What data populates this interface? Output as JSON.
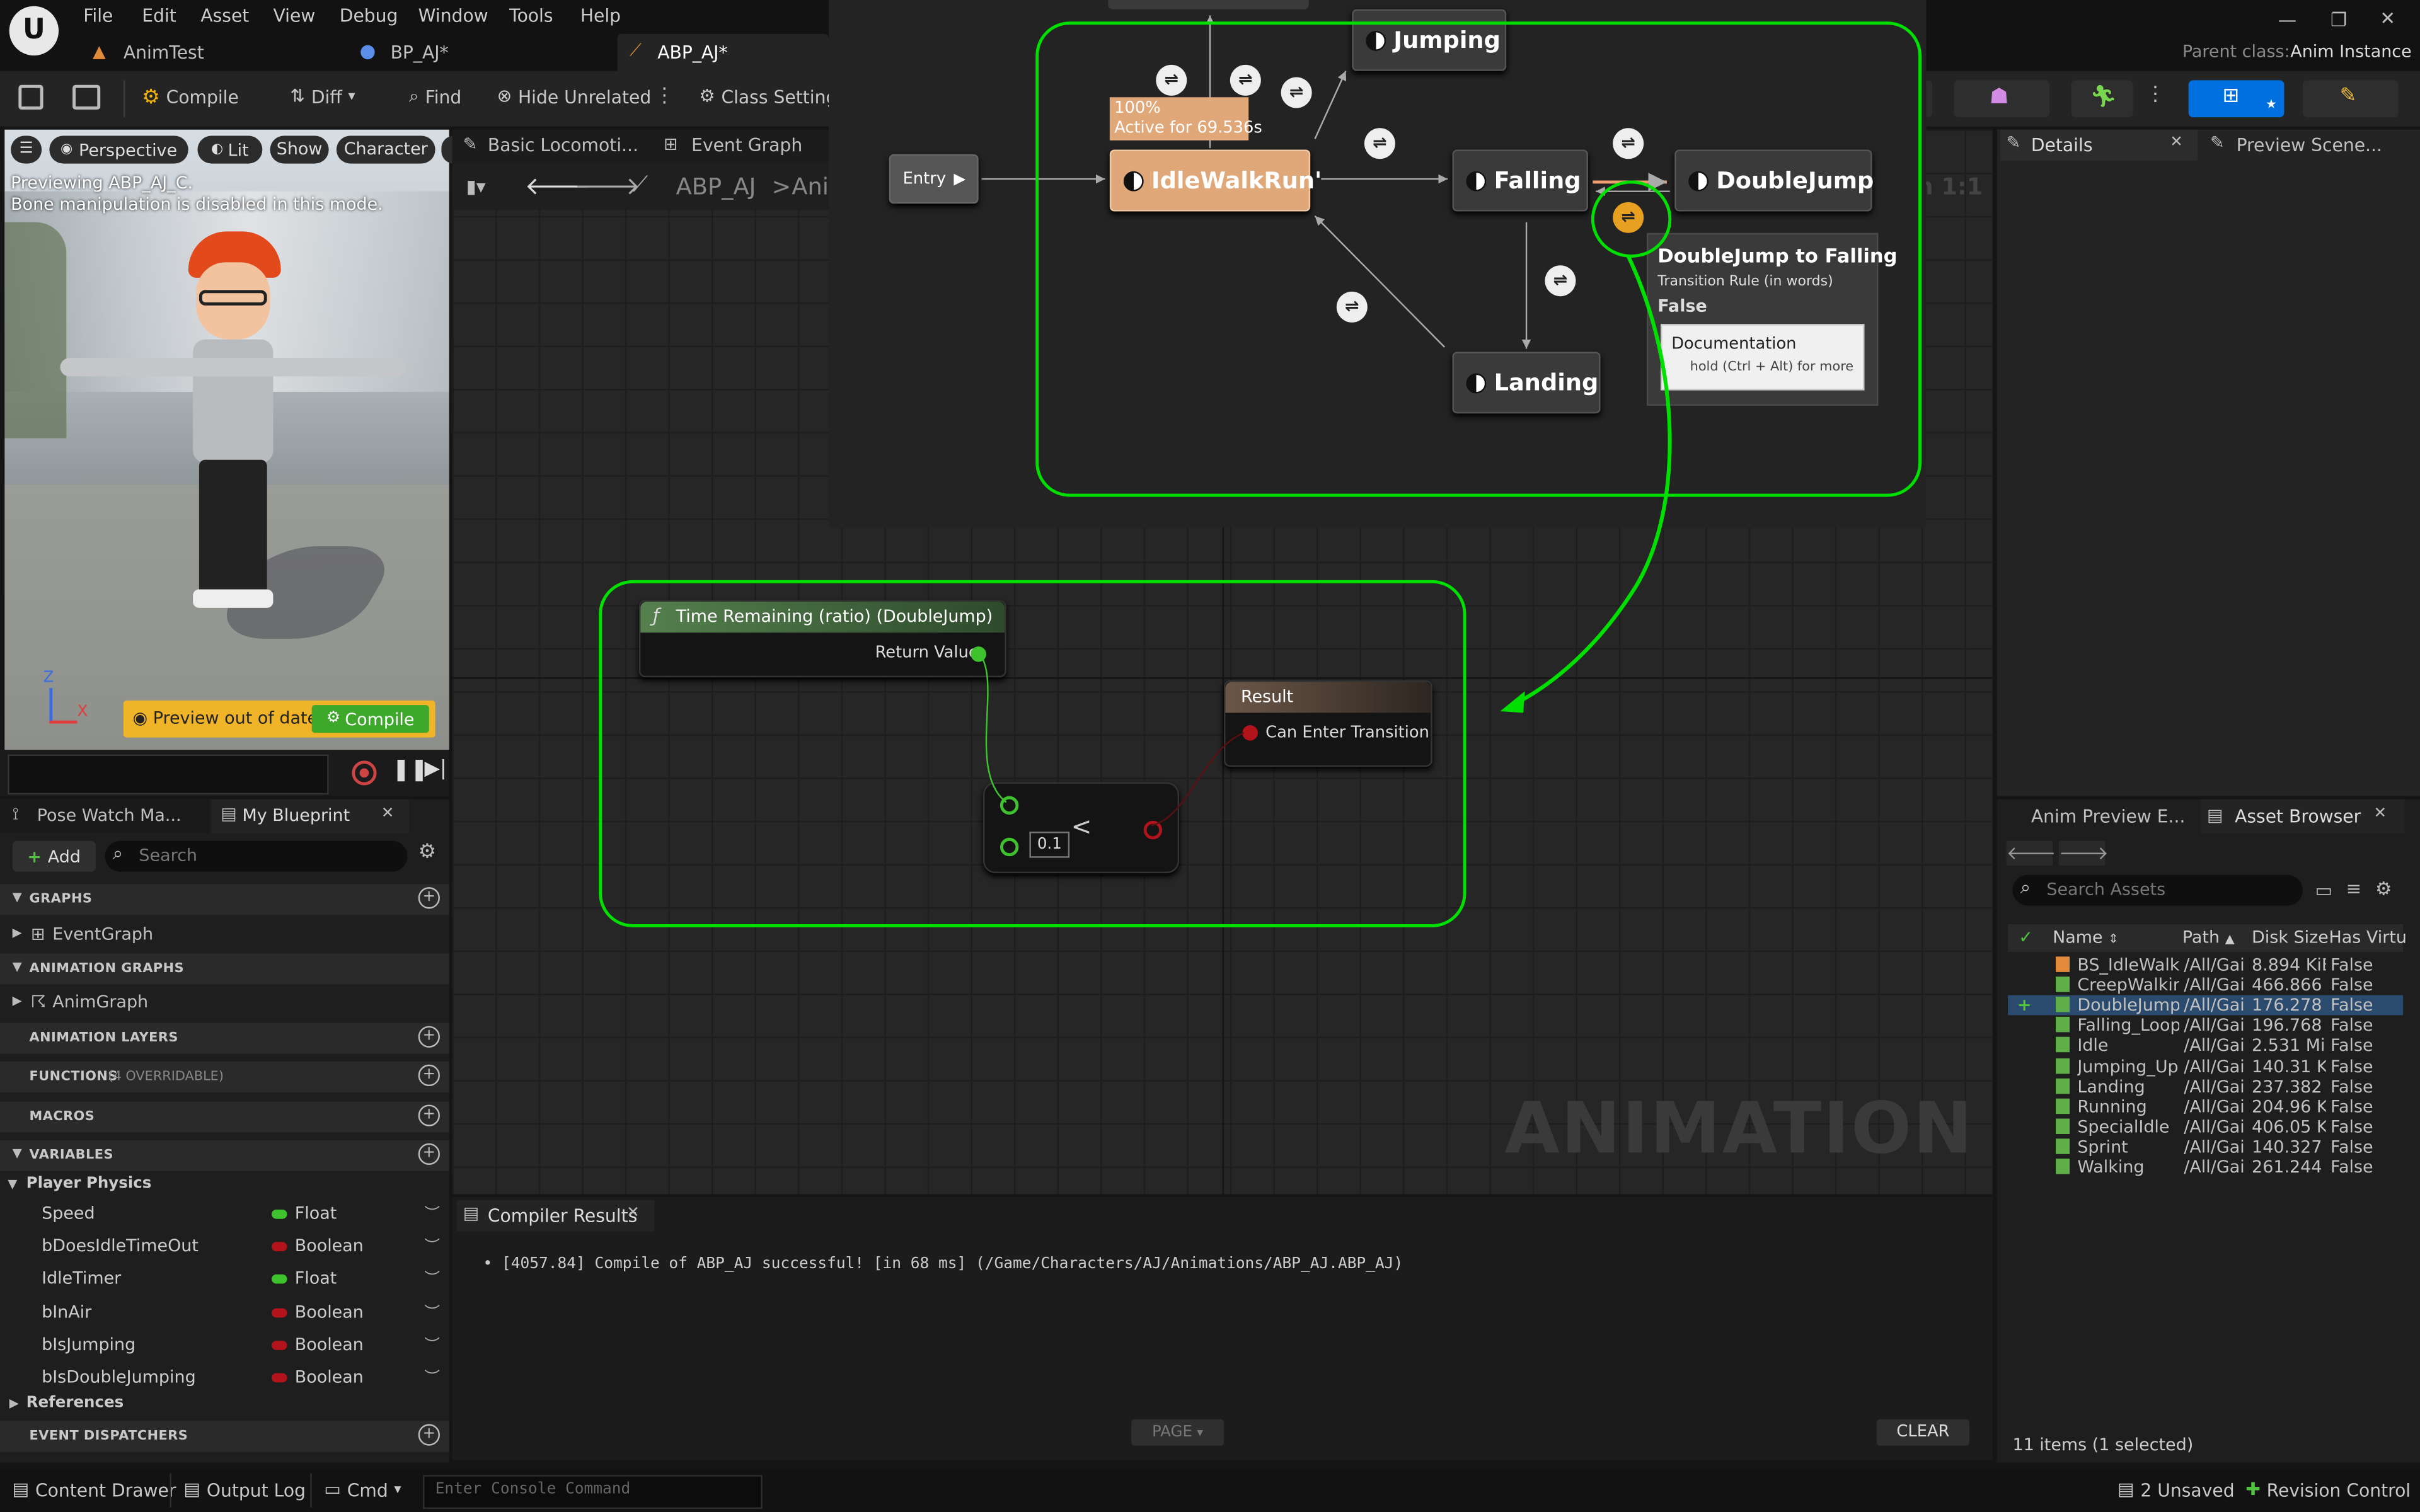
{
  "menu": {
    "items": [
      "File",
      "Edit",
      "Asset",
      "View",
      "Debug",
      "Window",
      "Tools",
      "Help"
    ]
  },
  "tabs": [
    {
      "label": "AnimTest"
    },
    {
      "label": "BP_AJ*"
    },
    {
      "label": "ABP_AJ*"
    }
  ],
  "parent_class": {
    "label": "Parent class:",
    "value": "Anim Instance"
  },
  "toolbar": {
    "compile": "Compile",
    "diff": "Diff",
    "find": "Find",
    "hide_unrelated": "Hide Unrelated",
    "class_settings": "Class Setting"
  },
  "viewport": {
    "perspective": "Perspective",
    "lit": "Lit",
    "show": "Show",
    "character": "Character",
    "preview_line1": "Previewing ABP_AJ_C.",
    "preview_line2": "Bone manipulation is disabled in this mode.",
    "preview_out_of_date": "Preview out of date",
    "compile": "Compile",
    "axis_z": "Z",
    "axis_x": "X"
  },
  "graph_tabs": {
    "basic": "Basic Locomoti...",
    "event_graph": "Event Graph"
  },
  "breadcrumb": {
    "root": "ABP_AJ",
    "sep": ">",
    "child": "Ani"
  },
  "zoom": "m 1:1",
  "state_machine": {
    "entry": "Entry",
    "states": {
      "idle": "IdleWalkRun'",
      "falling": "Falling",
      "jumping": "Jumping",
      "doublejump": "DoubleJump",
      "landing": "Landing"
    },
    "active_pct": "100%",
    "active_for": "Active for 69.536s"
  },
  "tooltip": {
    "title": "DoubleJump to Falling",
    "subtitle": "Transition Rule (in words)",
    "value": "False",
    "doc_title": "Documentation",
    "doc_hint": "hold (Ctrl + Alt) for more"
  },
  "rule_graph": {
    "func_title": "Time Remaining (ratio) (DoubleJump)",
    "return_value": "Return Value",
    "result_title": "Result",
    "can_enter": "Can Enter Transition",
    "compare_value": "0.1",
    "compare_op": "<"
  },
  "watermark": "ANIMATION",
  "left_tabs": {
    "pose_watch": "Pose Watch Ma...",
    "my_blueprint": "My Blueprint"
  },
  "my_blueprint": {
    "add": "Add",
    "search_placeholder": "Search",
    "graphs": "GRAPHS",
    "event_graph": "EventGraph",
    "anim_graphs": "ANIMATION GRAPHS",
    "anim_graph": "AnimGraph",
    "anim_layers": "ANIMATION LAYERS",
    "functions": "FUNCTIONS",
    "functions_note": "(4 OVERRIDABLE)",
    "macros": "MACROS",
    "variables": "VARIABLES",
    "player_physics": "Player Physics",
    "references": "References",
    "dispatchers": "EVENT DISPATCHERS"
  },
  "variables": [
    {
      "name": "Speed",
      "type": "Float",
      "color": "#3ec32e"
    },
    {
      "name": "bDoesIdleTimeOut",
      "type": "Boolean",
      "color": "#b3141b"
    },
    {
      "name": "IdleTimer",
      "type": "Float",
      "color": "#3ec32e"
    },
    {
      "name": "bInAir",
      "type": "Boolean",
      "color": "#b3141b"
    },
    {
      "name": "bIsJumping",
      "type": "Boolean",
      "color": "#b3141b"
    },
    {
      "name": "bIsDoubleJumping",
      "type": "Boolean",
      "color": "#b3141b"
    }
  ],
  "compiler": {
    "tab": "Compiler Results",
    "message": "[4057.84] Compile of ABP_AJ successful! [in 68 ms] (/Game/Characters/AJ/Animations/ABP_AJ.ABP_AJ)",
    "page": "PAGE",
    "clear": "CLEAR"
  },
  "right_tabs": {
    "details": "Details",
    "preview_scene": "Preview Scene...",
    "anim_preview": "Anim Preview E...",
    "asset_browser": "Asset Browser"
  },
  "asset_browser": {
    "search_placeholder": "Search Assets",
    "columns": [
      "Name",
      "Path",
      "Disk Size",
      "Has Virtu"
    ],
    "rows": [
      {
        "name": "BS_IdleWalkI",
        "path": "/All/Gai",
        "size": "8.894 KiE",
        "virt": "False"
      },
      {
        "name": "CreepWalking",
        "path": "/All/Gai",
        "size": "466.866",
        "virt": "False"
      },
      {
        "name": "DoubleJump",
        "path": "/All/Gai",
        "size": "176.278",
        "virt": "False"
      },
      {
        "name": "Falling_Loop",
        "path": "/All/Gai",
        "size": "196.768",
        "virt": "False"
      },
      {
        "name": "Idle",
        "path": "/All/Gai",
        "size": "2.531 Mi",
        "virt": "False"
      },
      {
        "name": "Jumping_Up",
        "path": "/All/Gai",
        "size": "140.31 K",
        "virt": "False"
      },
      {
        "name": "Landing",
        "path": "/All/Gai",
        "size": "237.382",
        "virt": "False"
      },
      {
        "name": "Running",
        "path": "/All/Gai",
        "size": "204.96 K",
        "virt": "False"
      },
      {
        "name": "SpecialIdle",
        "path": "/All/Gai",
        "size": "406.05 K",
        "virt": "False"
      },
      {
        "name": "Sprint",
        "path": "/All/Gai",
        "size": "140.327",
        "virt": "False"
      },
      {
        "name": "Walking",
        "path": "/All/Gai",
        "size": "261.244",
        "virt": "False"
      }
    ],
    "footer": "11 items (1 selected)"
  },
  "status": {
    "content_drawer": "Content Drawer",
    "output_log": "Output Log",
    "cmd": "Cmd",
    "console_placeholder": "Enter Console Command",
    "unsaved": "2 Unsaved",
    "revision": "Revision Control"
  },
  "colors": {
    "accent": "#0070e0",
    "highlight": "#00e000",
    "active_state": "#e0a779",
    "selected_row": "#2b4b6e"
  }
}
